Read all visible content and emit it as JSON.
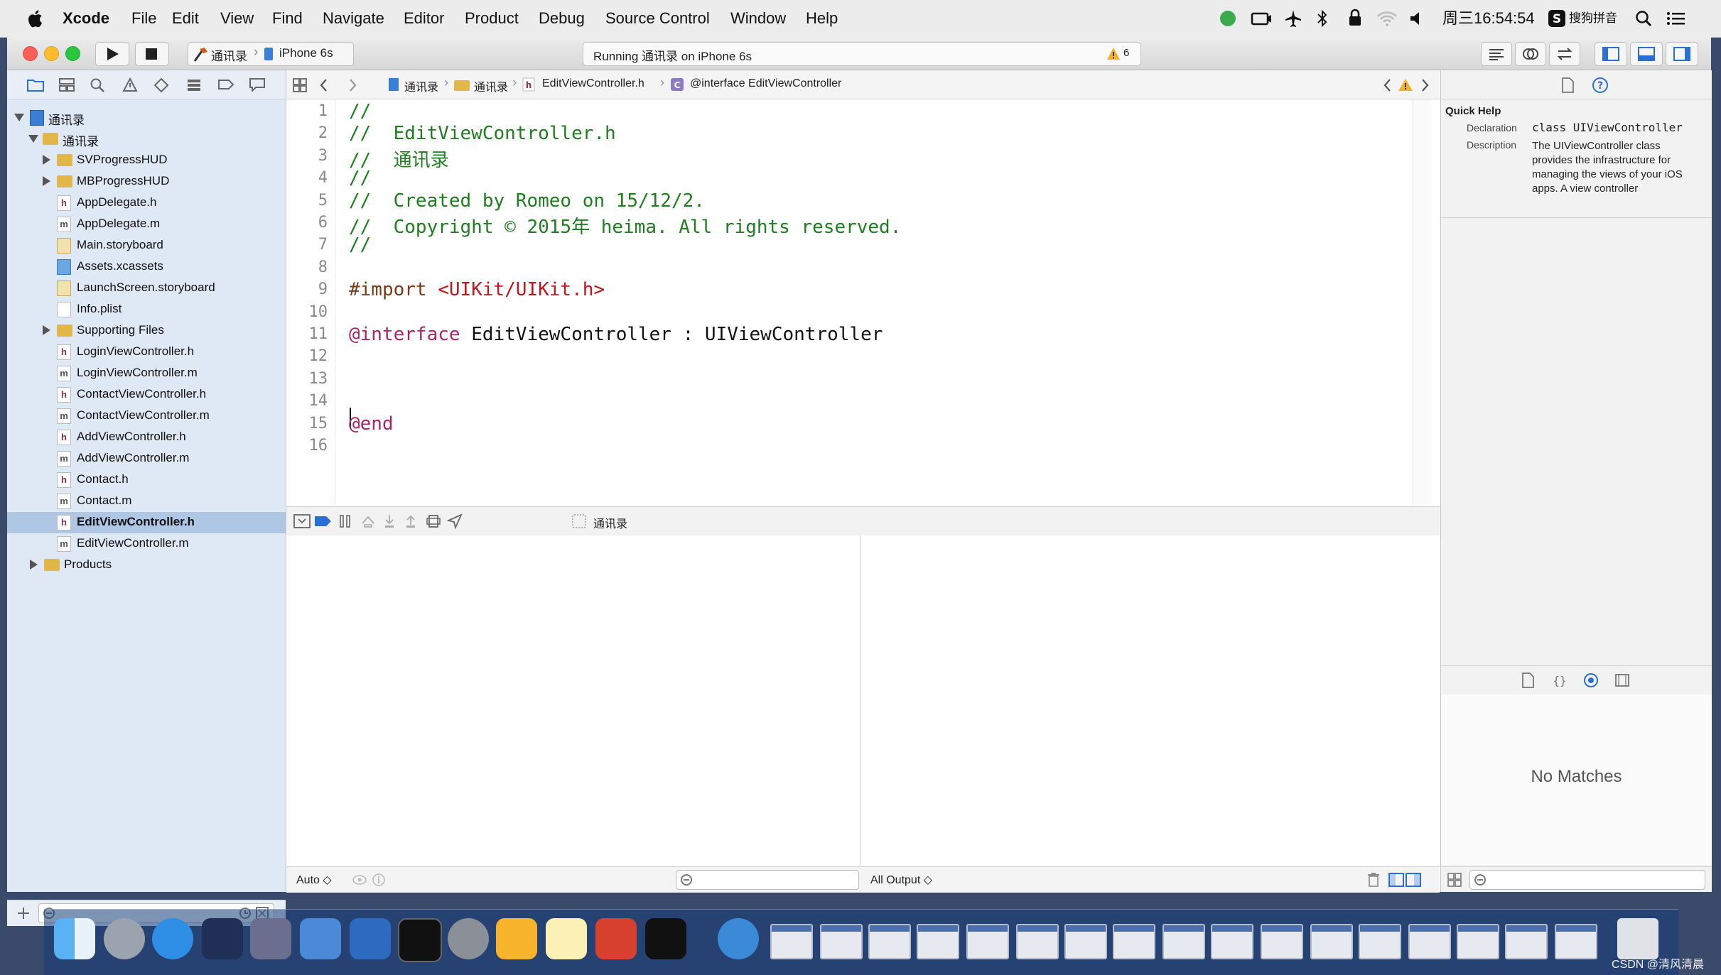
{
  "menubar": {
    "items": [
      "Xcode",
      "File",
      "Edit",
      "View",
      "Find",
      "Navigate",
      "Editor",
      "Product",
      "Debug",
      "Source Control",
      "Window",
      "Help"
    ],
    "clock": "周三16:54:54",
    "ime": "搜狗拼音"
  },
  "toolbar": {
    "scheme": "通讯录",
    "device": "iPhone 6s",
    "status": "Running 通讯录 on iPhone 6s",
    "warning_count": "6"
  },
  "navigator": {
    "project": "通讯录",
    "group": "通讯录",
    "items": [
      {
        "label": "SVProgressHUD",
        "kind": "folder",
        "indent": 2,
        "disclosure": "closed"
      },
      {
        "label": "MBProgressHUD",
        "kind": "folder",
        "indent": 2,
        "disclosure": "closed"
      },
      {
        "label": "AppDelegate.h",
        "kind": "h",
        "indent": 2
      },
      {
        "label": "AppDelegate.m",
        "kind": "m",
        "indent": 2
      },
      {
        "label": "Main.storyboard",
        "kind": "storyboard",
        "indent": 2
      },
      {
        "label": "Assets.xcassets",
        "kind": "xcassets",
        "indent": 2
      },
      {
        "label": "LaunchScreen.storyboard",
        "kind": "storyboard",
        "indent": 2
      },
      {
        "label": "Info.plist",
        "kind": "plist",
        "indent": 2
      },
      {
        "label": "Supporting Files",
        "kind": "folder",
        "indent": 2,
        "disclosure": "closed"
      },
      {
        "label": "LoginViewController.h",
        "kind": "h",
        "indent": 2
      },
      {
        "label": "LoginViewController.m",
        "kind": "m",
        "indent": 2
      },
      {
        "label": "ContactViewController.h",
        "kind": "h",
        "indent": 2
      },
      {
        "label": "ContactViewController.m",
        "kind": "m",
        "indent": 2
      },
      {
        "label": "AddViewController.h",
        "kind": "h",
        "indent": 2
      },
      {
        "label": "AddViewController.m",
        "kind": "m",
        "indent": 2
      },
      {
        "label": "Contact.h",
        "kind": "h",
        "indent": 2
      },
      {
        "label": "Contact.m",
        "kind": "m",
        "indent": 2
      },
      {
        "label": "EditViewController.h",
        "kind": "h",
        "indent": 2,
        "selected": true
      },
      {
        "label": "EditViewController.m",
        "kind": "m",
        "indent": 2
      },
      {
        "label": "Products",
        "kind": "folder",
        "indent": 1,
        "disclosure": "closed"
      }
    ]
  },
  "jumpbar": {
    "crumbs": [
      "通讯录",
      "通讯录",
      "EditViewController.h",
      "@interface EditViewController"
    ]
  },
  "editor": {
    "lines": [
      {
        "n": "1",
        "segs": [
          {
            "t": "//",
            "c": "cmt"
          }
        ]
      },
      {
        "n": "2",
        "segs": [
          {
            "t": "//  EditViewController.h",
            "c": "cmt"
          }
        ]
      },
      {
        "n": "3",
        "segs": [
          {
            "t": "//  通讯录",
            "c": "cmt"
          }
        ]
      },
      {
        "n": "4",
        "segs": [
          {
            "t": "//",
            "c": "cmt"
          }
        ]
      },
      {
        "n": "5",
        "segs": [
          {
            "t": "//  Created by Romeo on 15/12/2.",
            "c": "cmt"
          }
        ]
      },
      {
        "n": "6",
        "segs": [
          {
            "t": "//  Copyright © 2015年 heima. All rights reserved.",
            "c": "cmt"
          }
        ]
      },
      {
        "n": "7",
        "segs": [
          {
            "t": "//",
            "c": "cmt"
          }
        ]
      },
      {
        "n": "8",
        "segs": []
      },
      {
        "n": "9",
        "segs": [
          {
            "t": "#import ",
            "c": "pre"
          },
          {
            "t": "<UIKit/UIKit.h>",
            "c": "str"
          }
        ]
      },
      {
        "n": "10",
        "segs": []
      },
      {
        "n": "11",
        "segs": [
          {
            "t": "@interface",
            "c": "kw"
          },
          {
            "t": " EditViewController : UIViewController",
            "c": "plain"
          }
        ]
      },
      {
        "n": "12",
        "segs": []
      },
      {
        "n": "13",
        "segs": []
      },
      {
        "n": "14",
        "segs": []
      },
      {
        "n": "15",
        "segs": [
          {
            "t": "@end",
            "c": "kw"
          }
        ]
      },
      {
        "n": "16",
        "segs": []
      }
    ]
  },
  "debugbar": {
    "target": "通讯录"
  },
  "bottom": {
    "auto_label": "Auto ◇",
    "output_label": "All Output ◇"
  },
  "inspector": {
    "title": "Quick Help",
    "declaration_label": "Declaration",
    "declaration_value": "class UIViewController",
    "description_label": "Description",
    "description_value": "The UIViewController class provides the infrastructure for managing the views of your iOS apps. A view controller",
    "no_matches": "No Matches"
  },
  "watermark": "CSDN @清风清晨",
  "colors": {
    "selection": "#afc6e4",
    "comment": "#1d7f1d",
    "keyword": "#b02266",
    "string": "#c4151b",
    "preprocessor": "#7a3a16"
  }
}
